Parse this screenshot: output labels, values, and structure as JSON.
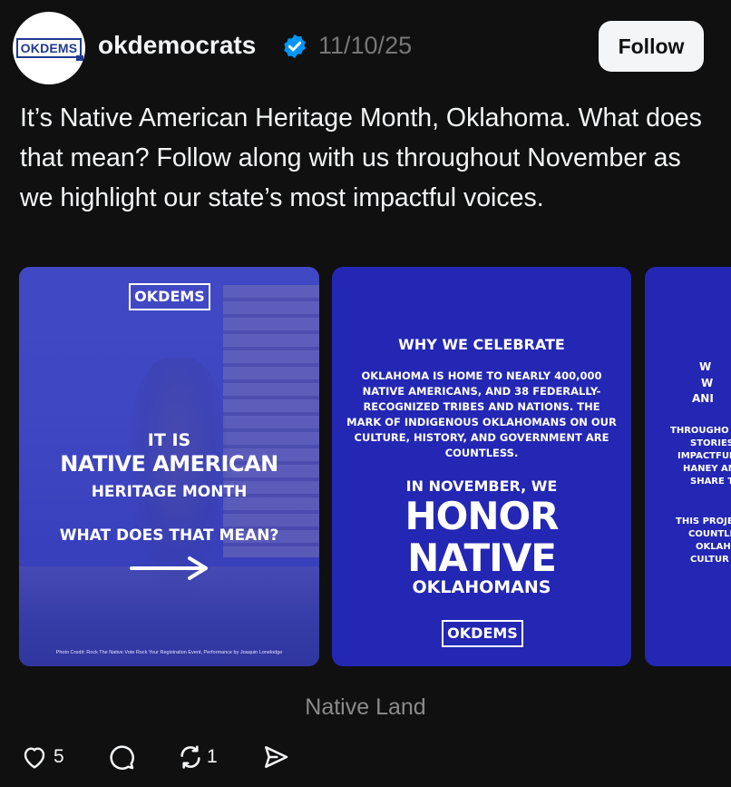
{
  "post": {
    "avatar_text": "OKDEMS",
    "username": "okdemocrats",
    "timestamp": "11/10/25",
    "follow_label": "Follow",
    "caption": "It’s Native American Heritage Month, Oklahoma. What does that mean? Follow along with us throughout November as we highlight our state’s most impactful voices."
  },
  "carousel": {
    "card1": {
      "logo": "OKDEMS",
      "line1": "IT IS",
      "line2": "NATIVE AMERICAN",
      "line3": "HERITAGE MONTH",
      "line4": "WHAT DOES THAT MEAN?",
      "credit": "Photo Credit: Rock The Native Vote Rock Your Registration Event, Performance by Joaquin Lonelodge"
    },
    "card2": {
      "heading": "WHY WE CELEBRATE",
      "body": "OKLAHOMA IS HOME TO NEARLY 400,000 NATIVE AMERICANS, AND 38 FEDERALLY-RECOGNIZED TRIBES AND NATIONS. THE MARK OF INDIGENOUS OKLAHOMANS ON OUR CULTURE, HISTORY, AND GOVERNMENT ARE COUNTLESS.",
      "sub": "IN NOVEMBER, WE",
      "big1": "HONOR",
      "big2": "NATIVE",
      "tail": "OKLAHOMANS",
      "logo": "OKDEMS"
    },
    "card3": {
      "l1": "W",
      "l2": "W",
      "l3": "ANI",
      "l4": "THROUGHO",
      "l5": "STORIES",
      "l6": "IMPACTFUL",
      "l7": "HANEY AN",
      "l8": "SHARE T",
      "l9": "THIS PROJE",
      "l10": "COUNTLE",
      "l11": "OKLAHO",
      "l12": "CULTUR"
    }
  },
  "footer_label": "Native Land",
  "actions": {
    "likes": "5",
    "reposts": "1"
  },
  "colors": {
    "background": "#101010",
    "card_blue": "#2327b3",
    "verified_blue": "#0095f6"
  },
  "icons": [
    "verified-badge-icon",
    "heart-icon",
    "comment-icon",
    "repost-icon",
    "share-icon",
    "arrow-right-icon"
  ]
}
